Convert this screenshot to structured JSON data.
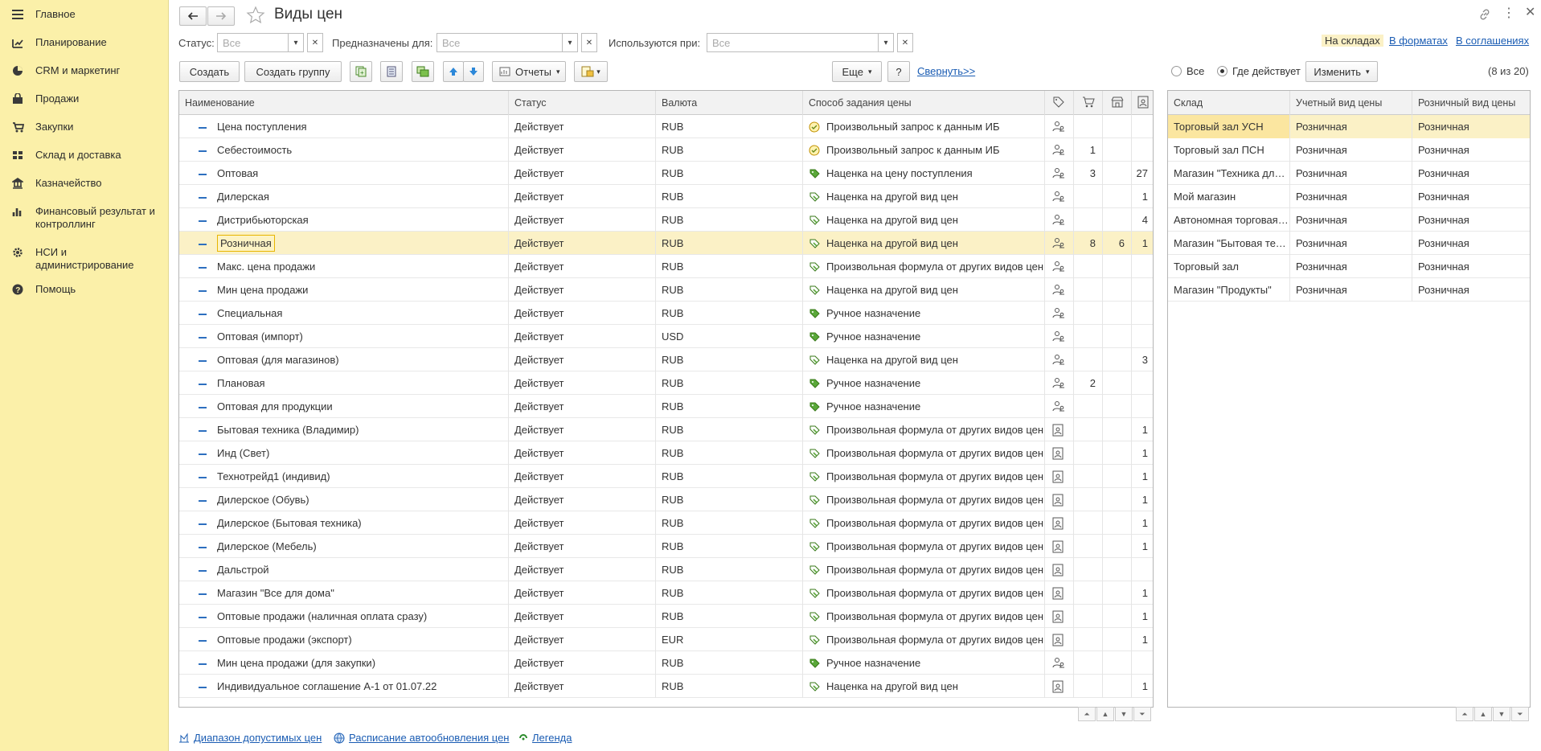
{
  "sidebar": {
    "items": [
      {
        "label": "Главное",
        "icon": "hamburger-icon"
      },
      {
        "label": "Планирование",
        "icon": "planning-icon"
      },
      {
        "label": "CRM и маркетинг",
        "icon": "pie-chart-icon"
      },
      {
        "label": "Продажи",
        "icon": "bag-icon"
      },
      {
        "label": "Закупки",
        "icon": "cart-icon"
      },
      {
        "label": "Склад и доставка",
        "icon": "warehouse-icon"
      },
      {
        "label": "Казначейство",
        "icon": "treasury-icon"
      },
      {
        "label": "Финансовый результат и контроллинг",
        "icon": "bar-chart-icon"
      },
      {
        "label": "НСИ и администрирование",
        "icon": "gear-icon"
      },
      {
        "label": "Помощь",
        "icon": "help-icon"
      }
    ]
  },
  "header": {
    "title": "Виды цен"
  },
  "filters": {
    "status_label": "Статус:",
    "status_value": "Все",
    "purpose_label": "Предназначены для:",
    "purpose_value": "Все",
    "used_label": "Используются при:",
    "used_value": "Все"
  },
  "right_links": {
    "warehouses": "На складах",
    "formats": "В форматах",
    "agreements": "В соглашениях"
  },
  "toolbar": {
    "create": "Создать",
    "create_group": "Создать группу",
    "reports": "Отчеты",
    "more": "Еще",
    "help": "?",
    "collapse": "Свернуть>>"
  },
  "right_toolbar": {
    "all": "Все",
    "active": "Где действует",
    "change": "Изменить",
    "count": "(8 из 20)"
  },
  "main_table": {
    "columns": [
      "Наименование",
      "Статус",
      "Валюта",
      "Способ задания цены"
    ],
    "rows": [
      {
        "name": "Цена поступления",
        "status": "Действует",
        "currency": "RUB",
        "method": "Произвольный запрос к данным ИБ",
        "mt": "query",
        "t": "people",
        "c1": "",
        "c2": "",
        "c3": ""
      },
      {
        "name": "Себестоимость",
        "status": "Действует",
        "currency": "RUB",
        "method": "Произвольный запрос к данным ИБ",
        "mt": "query",
        "t": "people",
        "c1": "1",
        "c2": "",
        "c3": ""
      },
      {
        "name": "Оптовая",
        "status": "Действует",
        "currency": "RUB",
        "method": "Наценка на цену поступления",
        "mt": "tag",
        "t": "people",
        "c1": "3",
        "c2": "",
        "c3": "27"
      },
      {
        "name": "Дилерская",
        "status": "Действует",
        "currency": "RUB",
        "method": "Наценка на другой вид цен",
        "mt": "markup",
        "t": "people",
        "c1": "",
        "c2": "",
        "c3": "1"
      },
      {
        "name": "Дистрибьюторская",
        "status": "Действует",
        "currency": "RUB",
        "method": "Наценка на другой вид цен",
        "mt": "markup",
        "t": "people",
        "c1": "",
        "c2": "",
        "c3": "4"
      },
      {
        "name": "Розничная",
        "status": "Действует",
        "currency": "RUB",
        "method": "Наценка на другой вид цен",
        "mt": "markup",
        "t": "people",
        "c1": "8",
        "c2": "6",
        "c3": "1",
        "selected": true
      },
      {
        "name": "Макс. цена продажи",
        "status": "Действует",
        "currency": "RUB",
        "method": "Произвольная формула от других видов цен",
        "mt": "markup",
        "t": "people",
        "c1": "",
        "c2": "",
        "c3": ""
      },
      {
        "name": "Мин цена продажи",
        "status": "Действует",
        "currency": "RUB",
        "method": "Наценка на другой вид цен",
        "mt": "markup",
        "t": "people",
        "c1": "",
        "c2": "",
        "c3": ""
      },
      {
        "name": "Специальная",
        "status": "Действует",
        "currency": "RUB",
        "method": "Ручное назначение",
        "mt": "tag",
        "t": "people",
        "c1": "",
        "c2": "",
        "c3": ""
      },
      {
        "name": "Оптовая (импорт)",
        "status": "Действует",
        "currency": "USD",
        "method": "Ручное назначение",
        "mt": "tag",
        "t": "people",
        "c1": "",
        "c2": "",
        "c3": ""
      },
      {
        "name": "Оптовая (для магазинов)",
        "status": "Действует",
        "currency": "RUB",
        "method": "Наценка на другой вид цен",
        "mt": "markup",
        "t": "people",
        "c1": "",
        "c2": "",
        "c3": "3"
      },
      {
        "name": "Плановая",
        "status": "Действует",
        "currency": "RUB",
        "method": "Ручное назначение",
        "mt": "tag",
        "t": "people",
        "c1": "2",
        "c2": "",
        "c3": ""
      },
      {
        "name": "Оптовая для продукции",
        "status": "Действует",
        "currency": "RUB",
        "method": "Ручное назначение",
        "mt": "tag",
        "t": "people",
        "c1": "",
        "c2": "",
        "c3": ""
      },
      {
        "name": "Бытовая техника (Владимир)",
        "status": "Действует",
        "currency": "RUB",
        "method": "Произвольная формула от других видов цен",
        "mt": "markup",
        "t": "doc",
        "c1": "",
        "c2": "",
        "c3": "1"
      },
      {
        "name": "Инд (Свет)",
        "status": "Действует",
        "currency": "RUB",
        "method": "Произвольная формула от других видов цен",
        "mt": "markup",
        "t": "doc",
        "c1": "",
        "c2": "",
        "c3": "1"
      },
      {
        "name": "Технотрейд1 (индивид)",
        "status": "Действует",
        "currency": "RUB",
        "method": "Произвольная формула от других видов цен",
        "mt": "markup",
        "t": "doc",
        "c1": "",
        "c2": "",
        "c3": "1"
      },
      {
        "name": "Дилерское (Обувь)",
        "status": "Действует",
        "currency": "RUB",
        "method": "Произвольная формула от других видов цен",
        "mt": "markup",
        "t": "doc",
        "c1": "",
        "c2": "",
        "c3": "1"
      },
      {
        "name": "Дилерское (Бытовая техника)",
        "status": "Действует",
        "currency": "RUB",
        "method": "Произвольная формула от других видов цен",
        "mt": "markup",
        "t": "doc",
        "c1": "",
        "c2": "",
        "c3": "1"
      },
      {
        "name": "Дилерское (Мебель)",
        "status": "Действует",
        "currency": "RUB",
        "method": "Произвольная формула от других видов цен",
        "mt": "markup",
        "t": "doc",
        "c1": "",
        "c2": "",
        "c3": "1"
      },
      {
        "name": "Дальстрой",
        "status": "Действует",
        "currency": "RUB",
        "method": "Произвольная формула от других видов цен",
        "mt": "markup",
        "t": "doc",
        "c1": "",
        "c2": "",
        "c3": ""
      },
      {
        "name": "Магазин \"Все для дома\"",
        "status": "Действует",
        "currency": "RUB",
        "method": "Произвольная формула от других видов цен",
        "mt": "markup",
        "t": "doc",
        "c1": "",
        "c2": "",
        "c3": "1"
      },
      {
        "name": "Оптовые продажи (наличная оплата сразу)",
        "status": "Действует",
        "currency": "RUB",
        "method": "Произвольная формула от других видов цен",
        "mt": "markup",
        "t": "doc",
        "c1": "",
        "c2": "",
        "c3": "1"
      },
      {
        "name": "Оптовые продажи (экспорт)",
        "status": "Действует",
        "currency": "EUR",
        "method": "Произвольная формула от других видов цен",
        "mt": "markup",
        "t": "doc",
        "c1": "",
        "c2": "",
        "c3": "1"
      },
      {
        "name": "Мин цена продажи (для закупки)",
        "status": "Действует",
        "currency": "RUB",
        "method": "Ручное назначение",
        "mt": "tag",
        "t": "people",
        "c1": "",
        "c2": "",
        "c3": ""
      },
      {
        "name": "Индивидуальное соглашение А-1 от 01.07.22",
        "status": "Действует",
        "currency": "RUB",
        "method": "Наценка на другой вид цен",
        "mt": "markup",
        "t": "doc",
        "c1": "",
        "c2": "",
        "c3": "1"
      }
    ]
  },
  "side_table": {
    "columns": [
      "Склад",
      "Учетный вид цены",
      "Розничный вид цены"
    ],
    "rows": [
      {
        "warehouse": "Торговый зал УСН",
        "account": "Розничная",
        "retail": "Розничная",
        "selected": true
      },
      {
        "warehouse": "Торговый зал ПСН",
        "account": "Розничная",
        "retail": "Розничная"
      },
      {
        "warehouse": "Магазин \"Техника для дома\"",
        "account": "Розничная",
        "retail": "Розничная"
      },
      {
        "warehouse": "Мой магазин",
        "account": "Розничная",
        "retail": "Розничная"
      },
      {
        "warehouse": "Автономная торговая точка",
        "account": "Розничная",
        "retail": "Розничная"
      },
      {
        "warehouse": "Магазин \"Бытовая техника\"",
        "account": "Розничная",
        "retail": "Розничная"
      },
      {
        "warehouse": "Торговый зал",
        "account": "Розничная",
        "retail": "Розничная"
      },
      {
        "warehouse": "Магазин \"Продукты\"",
        "account": "Розничная",
        "retail": "Розничная"
      }
    ]
  },
  "footer": {
    "range": "Диапазон допустимых цен",
    "schedule": "Расписание автообновления цен",
    "legend": "Легенда"
  }
}
